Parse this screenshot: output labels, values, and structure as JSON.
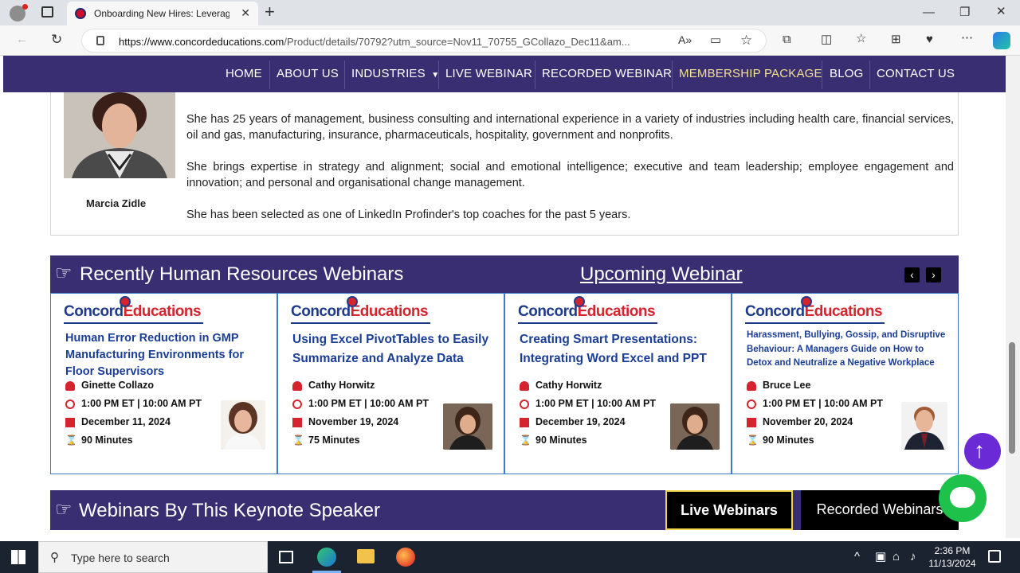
{
  "browser": {
    "tab_title": "Onboarding New Hires: Leverage",
    "new_tab_label": "+",
    "url_host": "https://www.concordeducations.com",
    "url_path": "/Product/details/70792?utm_source=Nov11_70755_GCollazo_Dec11&am..."
  },
  "nav": {
    "items": [
      "HOME",
      "ABOUT US",
      "INDUSTRIES",
      "LIVE WEBINAR",
      "RECORDED WEBINAR",
      "MEMBERSHIP PACKAGE",
      "BLOG",
      "CONTACT US"
    ],
    "highlight_color": "#f3e08a"
  },
  "speaker": {
    "name": "Marcia Zidle",
    "bio": [
      "She has 25 years of management, business consulting and international experience in a variety of industries including health care, financial services, oil and gas, manufacturing, insurance, pharmaceuticals, hospitality, government and nonprofits.",
      "She brings expertise in strategy and alignment; social and emotional intelligence; executive and team leadership; employee engagement and innovation; and personal and organisational change management.",
      "She has been selected as one of LinkedIn Profinder's top coaches for the past 5 years."
    ]
  },
  "recent": {
    "heading": "Recently Human Resources Webinars",
    "upcoming_link": "Upcoming Webinar",
    "prev": "‹",
    "next": "›",
    "logo_a": "Concord",
    "logo_b": "Educations",
    "cards": [
      {
        "title": "Human Error Reduction in GMP Manufacturing Environments for Floor Supervisors",
        "speaker": "Ginette Collazo",
        "time": "1:00 PM ET | 10:00 AM PT",
        "date": "December 11, 2024",
        "duration": "90 Minutes"
      },
      {
        "title": "Using Excel PivotTables to Easily Summarize and Analyze Data",
        "speaker": "Cathy Horwitz",
        "time": "1:00 PM ET | 10:00 AM PT",
        "date": "November 19, 2024",
        "duration": "75 Minutes"
      },
      {
        "title": "Creating Smart Presentations: Integrating Word Excel and PPT",
        "speaker": "Cathy Horwitz",
        "time": "1:00 PM ET | 10:00 AM PT",
        "date": "December 19, 2024",
        "duration": "90 Minutes"
      },
      {
        "title": "Harassment, Bullying, Gossip, and Disruptive Behaviour: A Managers Guide on How to Detox and Neutralize a Negative Workplace",
        "speaker": "Bruce Lee",
        "time": "1:00 PM ET | 10:00 AM PT",
        "date": "November 20, 2024",
        "duration": "90 Minutes"
      }
    ]
  },
  "keynote": {
    "heading": "Webinars By This Keynote Speaker",
    "tab_live": "Live Webinars",
    "tab_recorded": "Recorded Webinars"
  },
  "taskbar": {
    "search_placeholder": "Type here to search",
    "time": "2:36 PM",
    "date": "11/13/2024"
  },
  "colors": {
    "brand_purple": "#3a2e73",
    "brand_red": "#d6242e",
    "brand_blue": "#1f3b8b"
  }
}
